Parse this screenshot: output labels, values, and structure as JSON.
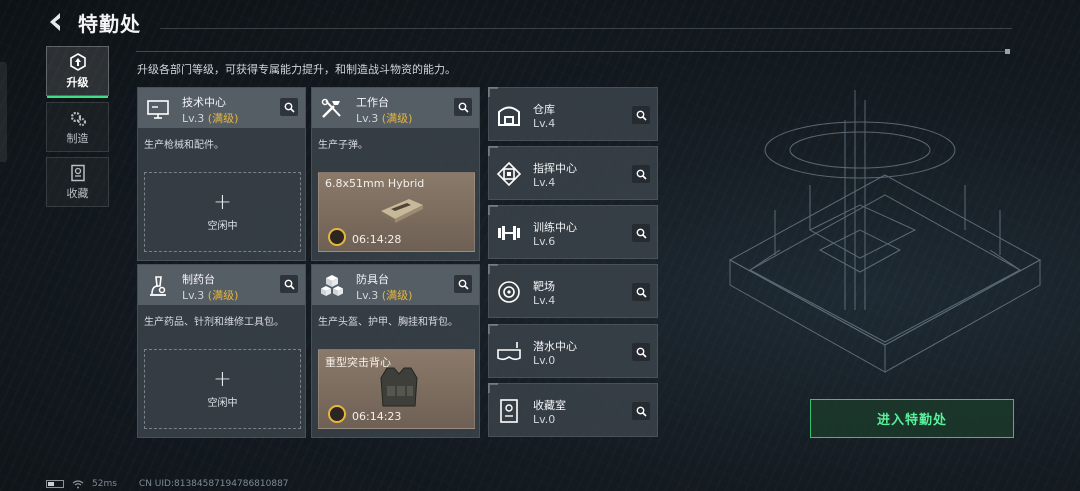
{
  "header": {
    "title": "特勤处",
    "subtitle": "升级各部门等级，可获得专属能力提升，和制造战斗物资的能力。"
  },
  "tabs": [
    {
      "label": "升级",
      "icon": "upgrade-icon",
      "active": true
    },
    {
      "label": "制造",
      "icon": "gears-icon",
      "active": false
    },
    {
      "label": "收藏",
      "icon": "collection-icon",
      "active": false
    }
  ],
  "cards": [
    {
      "name": "技术中心",
      "level": "Lv.3",
      "max": "(满级)",
      "desc": "生产枪械和配件。",
      "slot": {
        "type": "empty",
        "label": "空闲中"
      },
      "icon": "monitor-icon"
    },
    {
      "name": "工作台",
      "level": "Lv.3",
      "max": "(满级)",
      "desc": "生产子弹。",
      "slot": {
        "type": "producing",
        "item": "6.8x51mm Hybrid",
        "time": "06:14:28"
      },
      "icon": "tools-icon"
    },
    {
      "name": "制药台",
      "level": "Lv.3",
      "max": "(满级)",
      "desc": "生产药品、针剂和维修工具包。",
      "slot": {
        "type": "empty",
        "label": "空闲中"
      },
      "icon": "microscope-icon"
    },
    {
      "name": "防具台",
      "level": "Lv.3",
      "max": "(满级)",
      "desc": "生产头盔、护甲、胸挂和背包。",
      "slot": {
        "type": "producing",
        "item": "重型突击背心",
        "time": "06:14:23"
      },
      "icon": "armor-boxes-icon"
    }
  ],
  "facilities": [
    {
      "name": "仓库",
      "level": "Lv.4",
      "icon": "warehouse-icon"
    },
    {
      "name": "指挥中心",
      "level": "Lv.4",
      "icon": "chip-icon"
    },
    {
      "name": "训练中心",
      "level": "Lv.6",
      "icon": "dumbbell-icon"
    },
    {
      "name": "靶场",
      "level": "Lv.4",
      "icon": "target-icon"
    },
    {
      "name": "潜水中心",
      "level": "Lv.0",
      "icon": "diving-mask-icon"
    },
    {
      "name": "收藏室",
      "level": "Lv.0",
      "icon": "collection-room-icon"
    }
  ],
  "enter_button": "进入特勤处",
  "footer": {
    "ping": "52ms",
    "uid": "CN UID:8138458719478681088​7"
  }
}
